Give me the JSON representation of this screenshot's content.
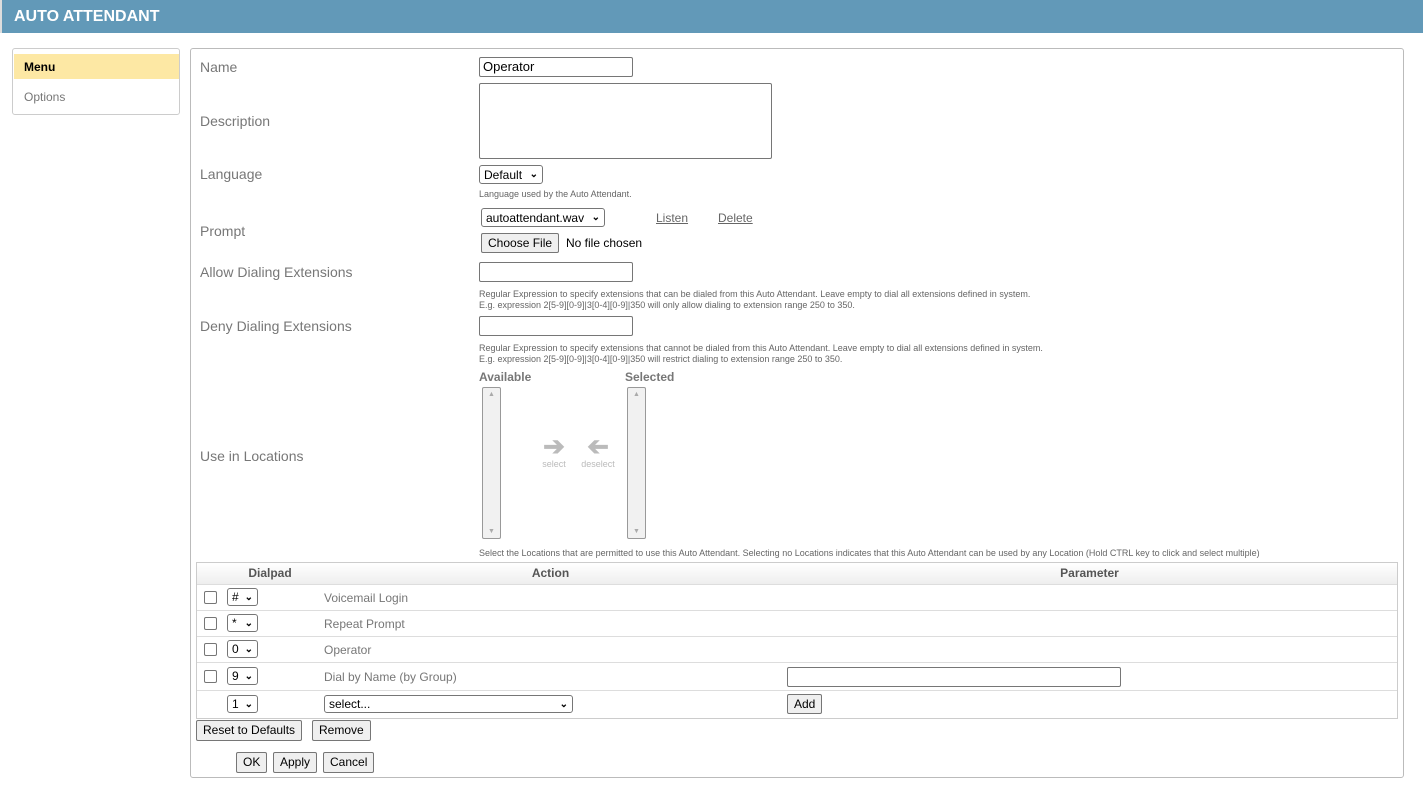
{
  "header": {
    "title": "AUTO ATTENDANT",
    "color": "#6299b8"
  },
  "sidebar": {
    "items": [
      {
        "label": "Menu",
        "active": true
      },
      {
        "label": "Options",
        "active": false
      }
    ],
    "active_color": "#fde8a4"
  },
  "form": {
    "name": {
      "label": "Name",
      "value": "Operator"
    },
    "description": {
      "label": "Description",
      "value": ""
    },
    "language": {
      "label": "Language",
      "value": "Default",
      "hint": "Language used by the Auto Attendant."
    },
    "prompt": {
      "label": "Prompt",
      "value": "autoattendant.wav",
      "listen": "Listen",
      "delete": "Delete",
      "choose_file": "Choose File",
      "no_file": "No file chosen"
    },
    "allow": {
      "label": "Allow Dialing Extensions",
      "value": "",
      "hint1": "Regular Expression to specify extensions that can be dialed from this Auto Attendant. Leave empty to dial all extensions defined in system.",
      "hint2": "E.g. expression 2[5-9][0-9]|3[0-4][0-9]|350 will only allow dialing to extension range 250 to 350."
    },
    "deny": {
      "label": "Deny Dialing Extensions",
      "value": "",
      "hint1": "Regular Expression to specify extensions that cannot be dialed from this Auto Attendant. Leave empty to dial all extensions defined in system.",
      "hint2": "E.g. expression 2[5-9][0-9]|3[0-4][0-9]|350 will restrict dialing to extension range 250 to 350."
    },
    "locations": {
      "label": "Use in Locations",
      "available": "Available",
      "selected": "Selected",
      "select": "select",
      "deselect": "deselect",
      "hint": "Select the Locations that are permitted to use this Auto Attendant. Selecting no Locations indicates that this Auto Attendant can be used by any Location (Hold CTRL key to click and select multiple)"
    }
  },
  "table": {
    "headers": [
      "Dialpad",
      "Action",
      "Parameter"
    ],
    "rows": [
      {
        "key": "#",
        "action": "Voicemail Login"
      },
      {
        "key": "*",
        "action": "Repeat Prompt"
      },
      {
        "key": "0",
        "action": "Operator"
      },
      {
        "key": "9",
        "action": "Dial by Name (by Group)",
        "parameter": ""
      }
    ],
    "new_row": {
      "key": "1",
      "action": "select...",
      "add": "Add"
    }
  },
  "buttons": {
    "reset": "Reset to Defaults",
    "remove": "Remove",
    "ok": "OK",
    "apply": "Apply",
    "cancel": "Cancel"
  }
}
